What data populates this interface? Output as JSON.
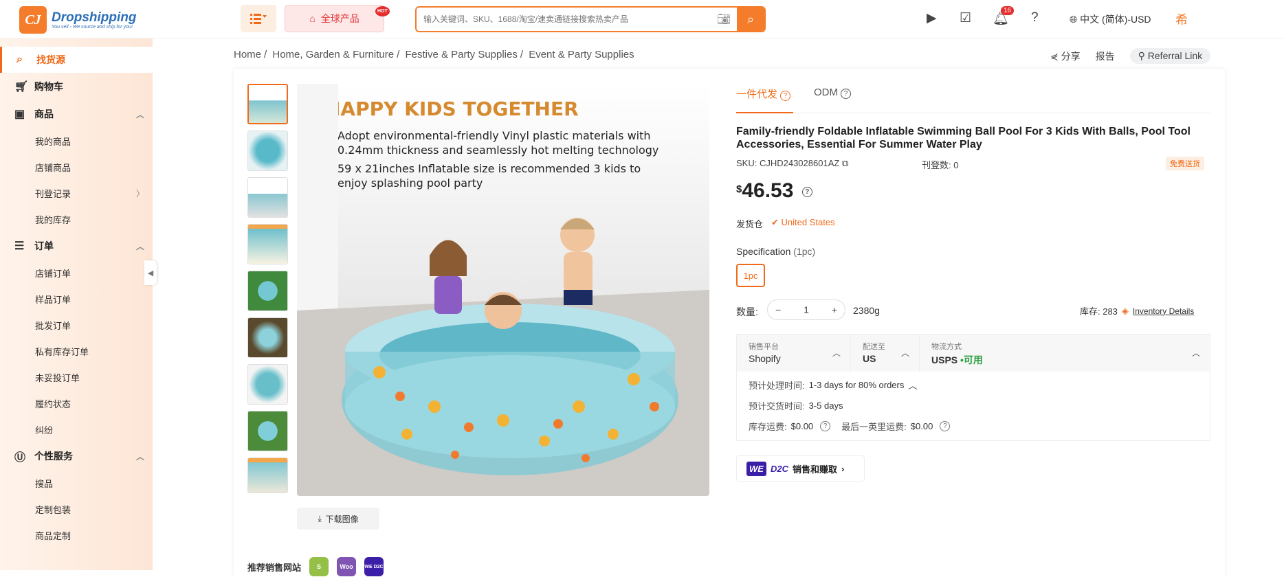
{
  "header": {
    "logo_mark": "CJ",
    "logo_name": "Dropshipping",
    "logo_sub": "You sell - We source and ship for you!",
    "global_label": "全球产品",
    "hot_badge": "HOT",
    "search_placeholder": "输入关键词、SKU、1688/淘宝/速卖通链接搜索热卖产品",
    "notif_count": "16",
    "language": "中文 (简体)-USD",
    "avatar_text": "希"
  },
  "sidebar": {
    "active_item": "找货源",
    "cart": "购物车",
    "products": {
      "label": "商品",
      "items": [
        "我的商品",
        "店铺商品",
        "刊登记录",
        "我的库存"
      ]
    },
    "orders": {
      "label": "订单",
      "items": [
        "店铺订单",
        "样品订单",
        "批发订单",
        "私有库存订单",
        "未妥投订单",
        "履约状态",
        "纠纷"
      ]
    },
    "services": {
      "label": "个性服务",
      "items": [
        "搜品",
        "定制包装",
        "商品定制"
      ]
    }
  },
  "breadcrumb": [
    "Home",
    "Home, Garden & Furniture",
    "Festive & Party Supplies",
    "Event & Party Supplies"
  ],
  "toplinks": {
    "share": "分享",
    "report": "报告",
    "referral": "Referral Link"
  },
  "product": {
    "image_title": "HAPPY KIDS TOGETHER",
    "image_bullets": [
      "Adopt environmental-friendly Vinyl plastic materials with 0.24mm thickness and seamlessly hot melting technology",
      "59 x 21inches Inflatable size is recommended 3 kids to enjoy splashing pool party"
    ],
    "download_label": "下载图像",
    "tabs": [
      "一件代发",
      "ODM"
    ],
    "title": "Family-friendly Foldable Inflatable Swimming Ball Pool For 3 Kids With Balls, Pool Tool Accessories, Essential For Summer Water Play",
    "sku": "SKU: CJHD243028601AZ",
    "listed": "刊登数: 0",
    "free_shipping": "免费送货",
    "currency": "$",
    "price": "46.53",
    "ship_from_label": "发货仓",
    "ship_from": "United States",
    "spec_label": "Specification",
    "spec_hint": "(1pc)",
    "spec_option": "1pc",
    "qty_label": "数量:",
    "qty": "1",
    "weight": "2380g",
    "stock_label": "库存: 283",
    "inventory_link": "Inventory Details"
  },
  "logistics": {
    "platform_label": "销售平台",
    "platform": "Shopify",
    "dest_label": "配送至",
    "dest": "US",
    "method_label": "物流方式",
    "method": "USPS",
    "available": "•可用",
    "processing_label": "预计处理时间:",
    "processing": "1-3 days for 80% orders",
    "delivery_label": "预计交货时间:",
    "delivery": "3-5 days",
    "inventory_fee_label": "库存运费:",
    "inventory_fee": "$0.00",
    "last_mile_label": "最后一英里运费:",
    "last_mile": "$0.00"
  },
  "wed2c": {
    "we": "WE",
    "d2c": "D2C",
    "label": "销售和赚取"
  },
  "recommend": {
    "label": "推荐销售网站",
    "sites": [
      "S",
      "Woo",
      "WE D2C"
    ]
  },
  "colors": {
    "accent": "#f06a1a",
    "brand_blue": "#2c6fb7",
    "purple": "#3c1fa8"
  }
}
